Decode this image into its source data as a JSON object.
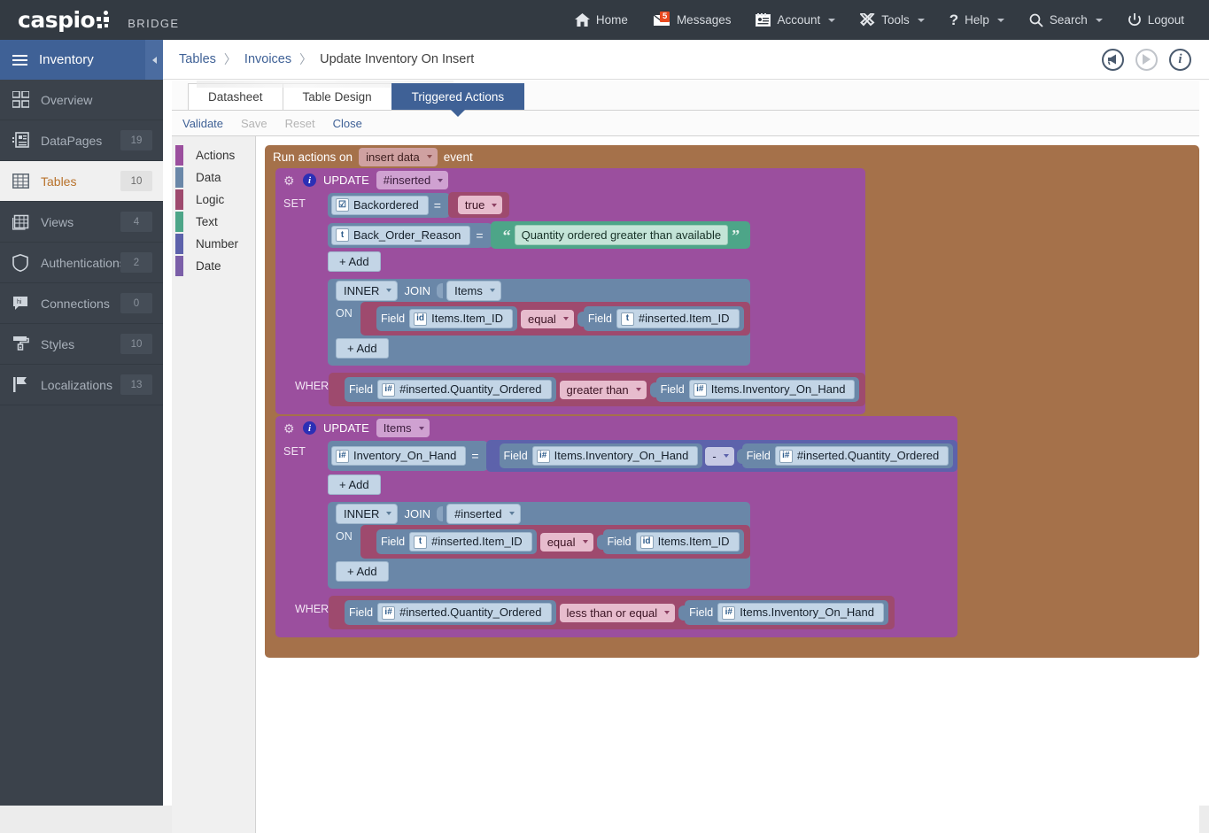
{
  "app": {
    "logo_main": "caspio",
    "logo_sub": "BRIDGE"
  },
  "topnav": [
    {
      "label": "Home",
      "icon": "home-icon",
      "caret": false,
      "badge": null
    },
    {
      "label": "Messages",
      "icon": "mail-icon",
      "caret": false,
      "badge": "5"
    },
    {
      "label": "Account",
      "icon": "account-card-icon",
      "caret": true,
      "badge": null
    },
    {
      "label": "Tools",
      "icon": "tools-icon",
      "caret": true,
      "badge": null
    },
    {
      "label": "Help",
      "icon": "question-mark-icon",
      "caret": true,
      "badge": null
    },
    {
      "label": "Search",
      "icon": "search-icon",
      "caret": true,
      "badge": null
    },
    {
      "label": "Logout",
      "icon": "power-icon",
      "caret": false,
      "badge": null
    }
  ],
  "sidebar": {
    "title": "Inventory",
    "items": [
      {
        "label": "Overview",
        "count": "",
        "icon": "grid-squares-icon",
        "active": false
      },
      {
        "label": "DataPages",
        "count": "19",
        "icon": "datapage-icon",
        "active": false
      },
      {
        "label": "Tables",
        "count": "10",
        "icon": "table-grid-icon",
        "active": true
      },
      {
        "label": "Views",
        "count": "4",
        "icon": "views-icon",
        "active": false
      },
      {
        "label": "Authentications",
        "count": "2",
        "icon": "shield-icon",
        "active": false
      },
      {
        "label": "Connections",
        "count": "0",
        "icon": "speech-bubble-icon",
        "active": false
      },
      {
        "label": "Styles",
        "count": "10",
        "icon": "paint-roller-icon",
        "active": false
      },
      {
        "label": "Localizations",
        "count": "13",
        "icon": "flag-icon",
        "active": false
      }
    ]
  },
  "breadcrumb": {
    "items": [
      "Tables",
      "Invoices",
      "Update Inventory On Insert"
    ],
    "separator": "〉",
    "icons": [
      "megaphone-icon",
      "play-icon",
      "info-icon"
    ]
  },
  "tabs": [
    {
      "label": "Datasheet",
      "active": false
    },
    {
      "label": "Table Design",
      "active": false
    },
    {
      "label": "Triggered Actions",
      "active": true
    }
  ],
  "toolbar": [
    {
      "label": "Validate",
      "enabled": true
    },
    {
      "label": "Save",
      "enabled": false
    },
    {
      "label": "Reset",
      "enabled": false
    },
    {
      "label": "Close",
      "enabled": true
    }
  ],
  "palette": [
    {
      "label": "Actions",
      "color": "#9b4f9e"
    },
    {
      "label": "Data",
      "color": "#6a87a8"
    },
    {
      "label": "Logic",
      "color": "#9e4a6e"
    },
    {
      "label": "Text",
      "color": "#4da588"
    },
    {
      "label": "Number",
      "color": "#5d62ab"
    },
    {
      "label": "Date",
      "color": "#7b5fa8"
    }
  ],
  "trigger": {
    "prefix": "Run actions on",
    "event": "insert data",
    "suffix": "event"
  },
  "action1": {
    "keyword": "UPDATE",
    "target": "#inserted",
    "set_label": "SET",
    "set_rows": [
      {
        "field": "Backordered",
        "field_icon": "checkbox-field-icon",
        "operator": "=",
        "value": "true",
        "value_type": "logic"
      },
      {
        "field": "Back_Order_Reason",
        "field_icon": "text-field-icon",
        "operator": "=",
        "value": "Quantity ordered greater than available",
        "value_type": "text",
        "quote_open": "“",
        "quote_close": "”"
      }
    ],
    "add_label": "+ Add",
    "join": {
      "type": "INNER",
      "keyword": "JOIN",
      "table": "Items",
      "on_label": "ON",
      "on": {
        "left_label": "Field",
        "left_field": "Items.Item_ID",
        "left_icon": "id-field-icon",
        "operator": "equal",
        "right_label": "Field",
        "right_field": "#inserted.Item_ID",
        "right_icon": "text-field-icon"
      },
      "add_label": "+ Add"
    },
    "where": {
      "label": "WHERE",
      "left_label": "Field",
      "left_field": "#inserted.Quantity_Ordered",
      "left_icon": "number-field-icon",
      "operator": "greater than",
      "right_label": "Field",
      "right_field": "Items.Inventory_On_Hand",
      "right_icon": "number-field-icon"
    }
  },
  "action2": {
    "keyword": "UPDATE",
    "target": "Items",
    "set_label": "SET",
    "set_row": {
      "field": "Inventory_On_Hand",
      "field_icon": "number-field-icon",
      "operator": "=",
      "expr_left_label": "Field",
      "expr_left_field": "Items.Inventory_On_Hand",
      "expr_left_icon": "number-field-icon",
      "expr_operator": "-",
      "expr_right_label": "Field",
      "expr_right_field": "#inserted.Quantity_Ordered",
      "expr_right_icon": "number-field-icon"
    },
    "add_label": "+ Add",
    "join": {
      "type": "INNER",
      "keyword": "JOIN",
      "table": "#inserted",
      "on_label": "ON",
      "on": {
        "left_label": "Field",
        "left_field": "#inserted.Item_ID",
        "left_icon": "text-field-icon",
        "operator": "equal",
        "right_label": "Field",
        "right_field": "Items.Item_ID",
        "right_icon": "id-field-icon"
      },
      "add_label": "+ Add"
    },
    "where": {
      "label": "WHERE",
      "left_label": "Field",
      "left_field": "#inserted.Quantity_Ordered",
      "left_icon": "number-field-icon",
      "operator": "less than or equal",
      "right_label": "Field",
      "right_field": "Items.Inventory_On_Hand",
      "right_icon": "number-field-icon"
    }
  },
  "field_icons": {
    "checkbox-field-icon": "☑",
    "text-field-icon": "t",
    "id-field-icon": "id",
    "number-field-icon": "i#"
  },
  "colors": {
    "topbar": "#333a42",
    "sidebar": "#3b424b",
    "accent": "#3f6196",
    "trigger_brown": "#a5714a",
    "action_purple": "#9b4f9e",
    "data_blue": "#6a87a8",
    "logic_maroon": "#9e4a6e",
    "text_green": "#4da588",
    "number_violet": "#5d62ab",
    "badge_orange": "#e8491f"
  }
}
